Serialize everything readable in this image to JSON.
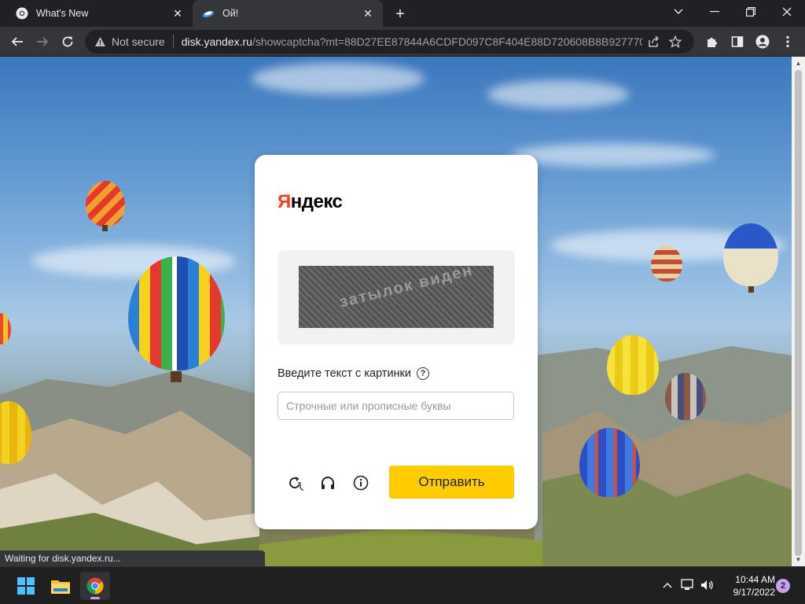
{
  "browser": {
    "tabs": [
      {
        "title": "What's New",
        "active": false
      },
      {
        "title": "Ой!",
        "active": true
      }
    ],
    "address": {
      "security_label": "Not secure",
      "host": "disk.yandex.ru",
      "path": "/showcaptcha?mt=88D27EE87844A6CDFD097C8F404E88D720608B8B927770C..."
    },
    "status_text": "Waiting for disk.yandex.ru..."
  },
  "captcha": {
    "logo": {
      "first_letter": "Я",
      "rest": "ндекс"
    },
    "image_text": "затылок виден",
    "label": "Введите текст с картинки",
    "help_symbol": "?",
    "input": {
      "value": "",
      "placeholder": "Строчные или прописные буквы"
    },
    "submit_label": "Отправить"
  },
  "taskbar": {
    "time": "10:44 AM",
    "date": "9/17/2022",
    "notification_count": "2"
  },
  "colors": {
    "yandex_red": "#fc3f1d",
    "submit_yellow": "#ffcc00",
    "chrome_dark": "#202124",
    "toolbar": "#35363a"
  }
}
